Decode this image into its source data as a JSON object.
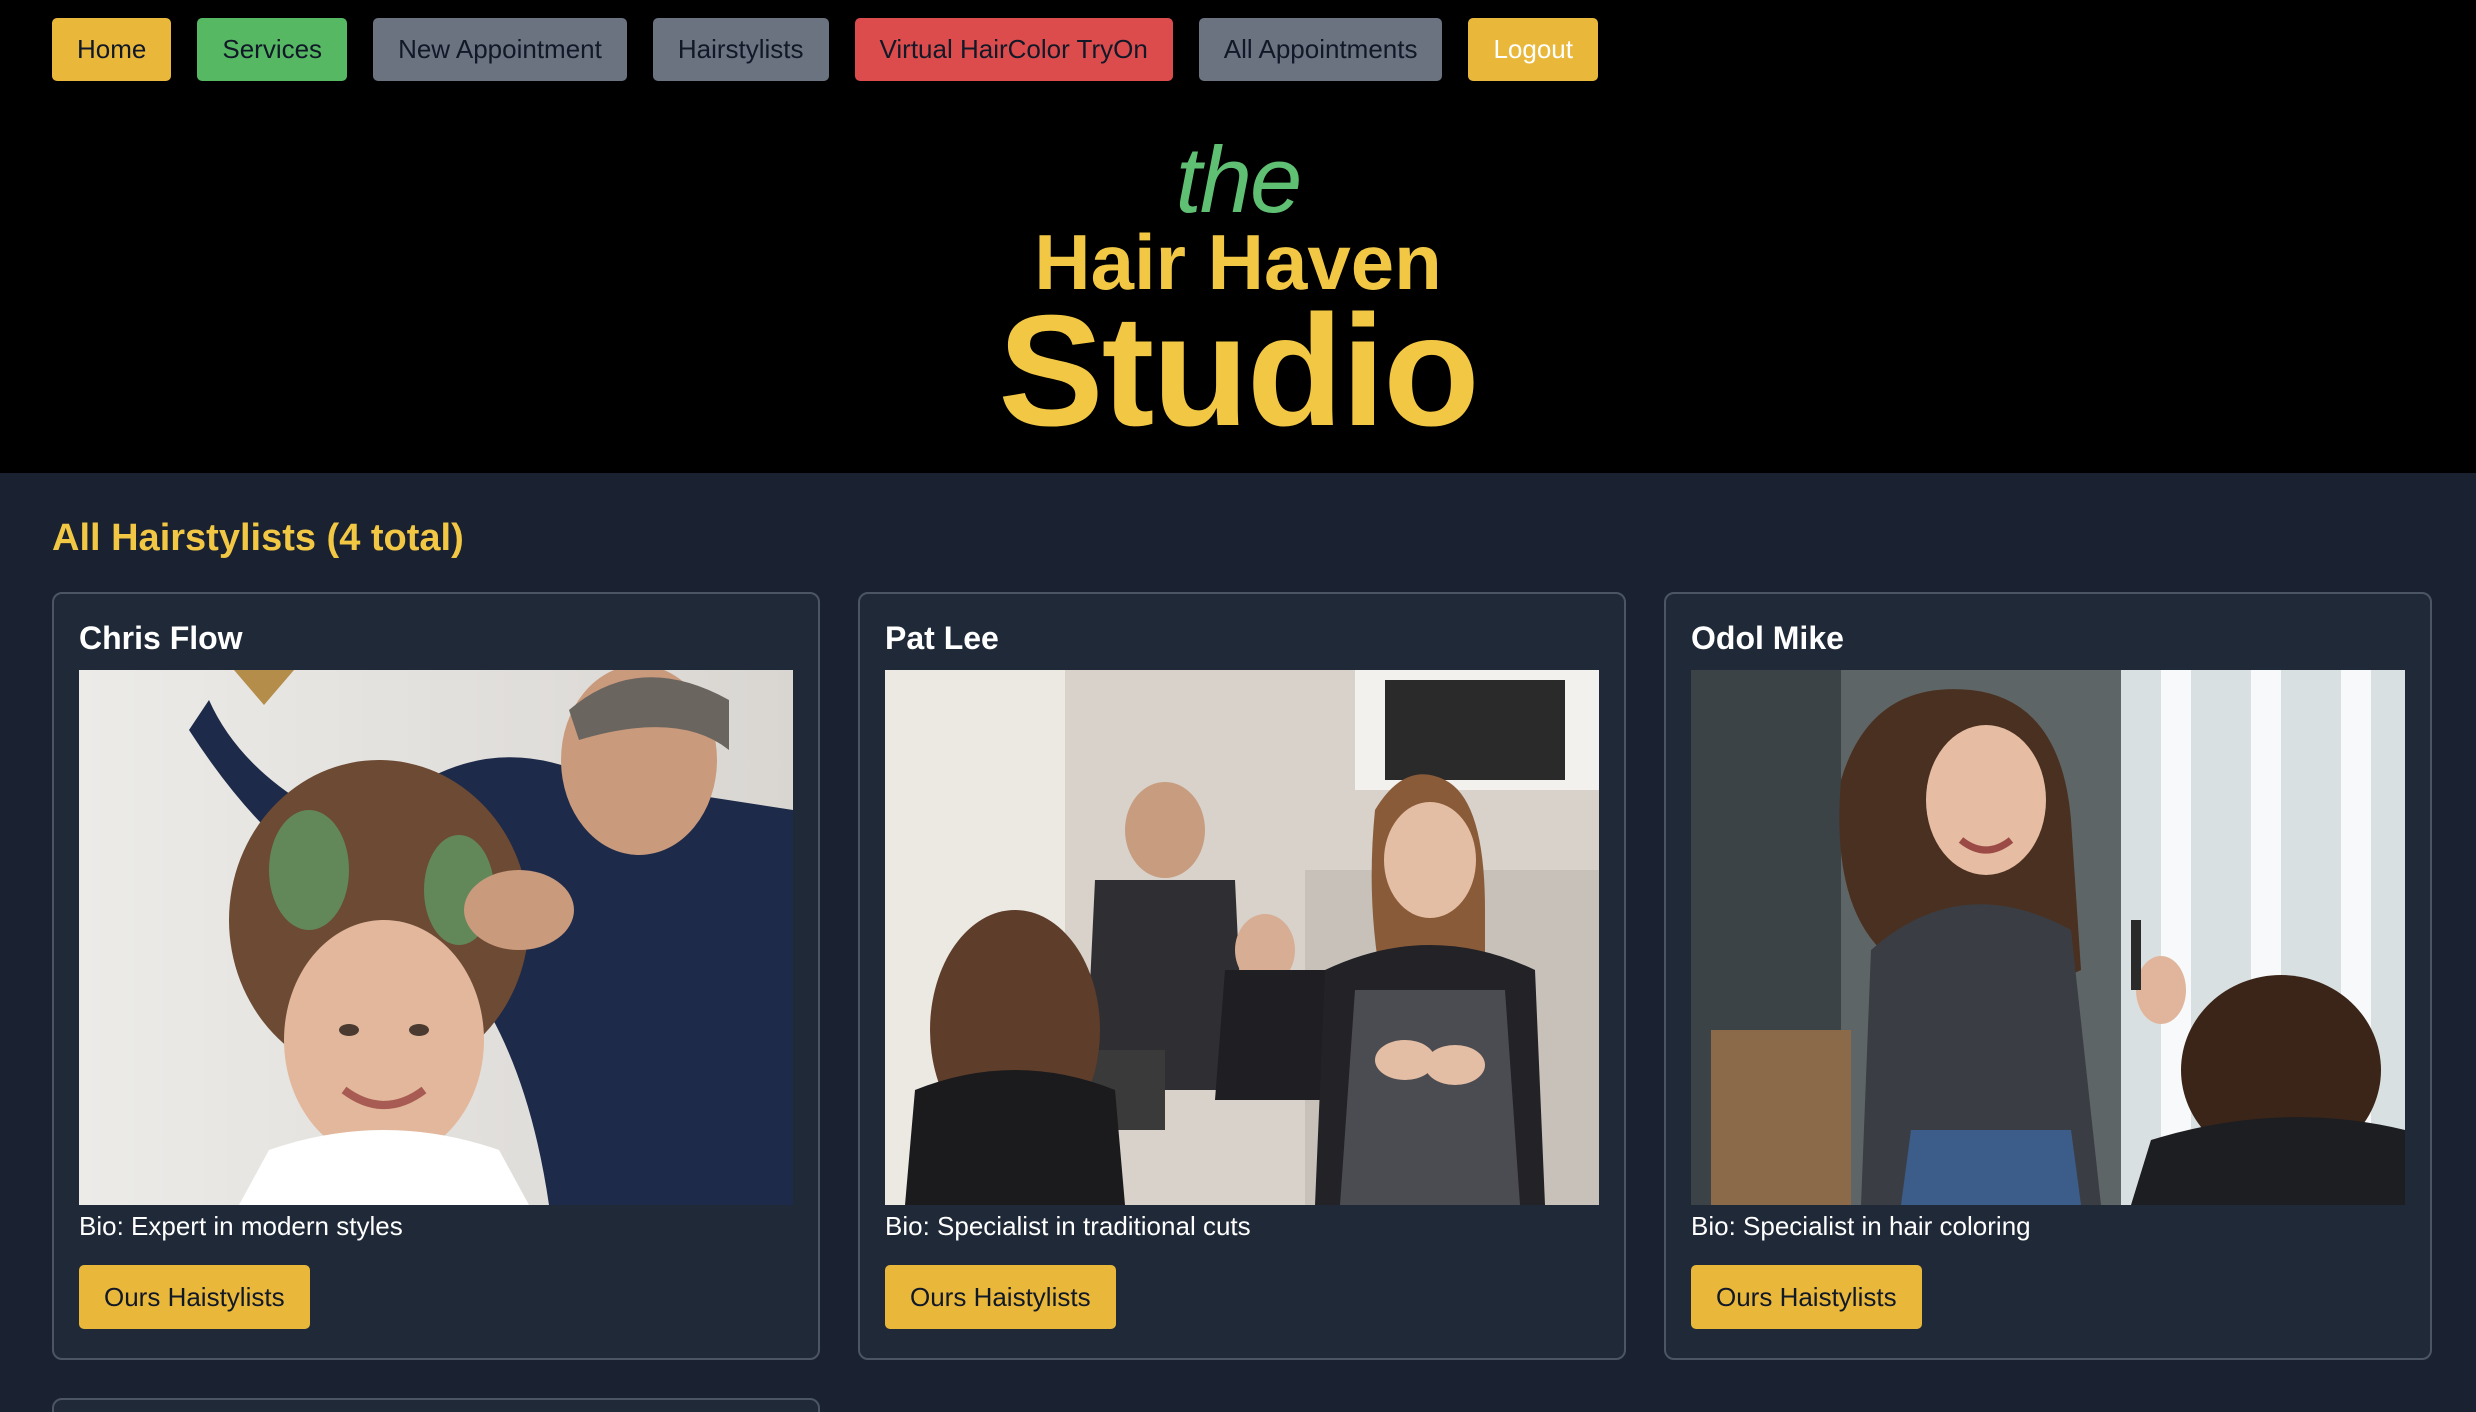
{
  "nav": {
    "items": [
      {
        "label": "Home",
        "style": "yellow"
      },
      {
        "label": "Services",
        "style": "green"
      },
      {
        "label": "New Appointment",
        "style": "gray"
      },
      {
        "label": "Hairstylists",
        "style": "gray"
      },
      {
        "label": "Virtual HairColor TryOn",
        "style": "red"
      },
      {
        "label": "All Appointments",
        "style": "gray"
      },
      {
        "label": "Logout",
        "style": "yellow"
      }
    ]
  },
  "logo": {
    "line1": "the",
    "line2": "Hair Haven",
    "line3": "Studio"
  },
  "main": {
    "title": "All Hairstylists (4 total)",
    "stylists": [
      {
        "name": "Chris Flow",
        "bio": "Bio: Expert in modern styles",
        "button": "Ours Haistylists",
        "photo_icon": "stylist-curling-hair-photo"
      },
      {
        "name": "Pat Lee",
        "bio": "Bio: Specialist in traditional cuts",
        "button": "Ours Haistylists",
        "photo_icon": "salon-stylist-apron-photo"
      },
      {
        "name": "Odol Mike",
        "bio": "Bio: Specialist in hair coloring",
        "button": "Ours Haistylists",
        "photo_icon": "stylist-with-client-photo"
      }
    ]
  },
  "colors": {
    "accent_yellow": "#f2c744",
    "logo_green": "#5fbf73",
    "page_bg": "#1a2231",
    "card_bg": "#1f2937"
  }
}
